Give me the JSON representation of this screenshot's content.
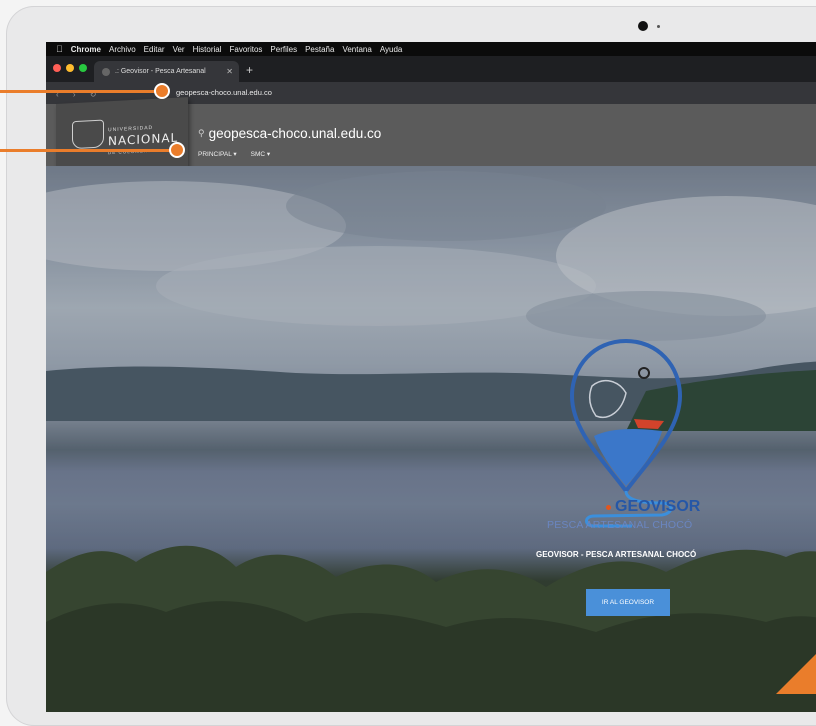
{
  "menubar": {
    "app": "Chrome",
    "items": [
      "Archivo",
      "Editar",
      "Ver",
      "Historial",
      "Favoritos",
      "Perfiles",
      "Pestaña",
      "Ventana",
      "Ayuda"
    ]
  },
  "browser": {
    "tab_title": ".: Geovisor - Pesca Artesanal",
    "url": "geopesca-choco.unal.edu.co"
  },
  "site": {
    "logo_small": "UNIVERSIDAD",
    "logo_big": "NACIONAL",
    "logo_country": "DE COLOMBIA",
    "title": "geopesca-choco.unal.edu.co",
    "nav": [
      "PRINCIPAL ▾",
      "SMC ▾"
    ]
  },
  "hero": {
    "logo_title": "GEOVISOR",
    "logo_subtitle": "PESCA ARTESANAL CHOCÓ",
    "caption": "GEOVISOR - PESCA ARTESANAL CHOCÓ",
    "cta": "IR AL GEOVISOR"
  },
  "colors": {
    "accent": "#ea7d2b",
    "header": "#5b5b5b",
    "cta": "#4a90d9",
    "geo_blue": "#2557a7"
  }
}
